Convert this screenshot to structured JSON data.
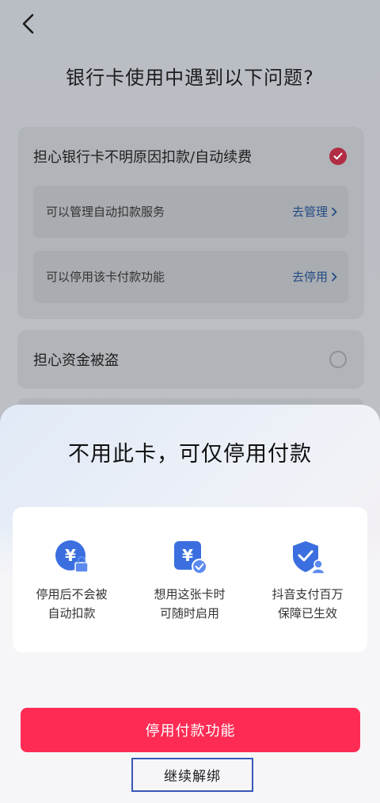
{
  "header": {
    "title": "银行卡使用中遇到以下问题?"
  },
  "issues": [
    {
      "label": "担心银行卡不明原因扣款/自动续费",
      "checked": true,
      "options": [
        {
          "label": "可以管理自动扣款服务",
          "action": "去管理"
        },
        {
          "label": "可以停用该卡付款功能",
          "action": "去停用"
        }
      ]
    },
    {
      "label": "担心资金被盗",
      "checked": false
    }
  ],
  "sheet": {
    "title": "不用此卡，可仅停用付款",
    "benefits": [
      {
        "icon": "yuan-lock-icon",
        "line1": "停用后不会被",
        "line2": "自动扣款"
      },
      {
        "icon": "yuan-card-check-icon",
        "line1": "想用这张卡时",
        "line2": "可随时启用"
      },
      {
        "icon": "shield-user-icon",
        "line1": "抖音支付百万",
        "line2": "保障已生效"
      }
    ],
    "primary_button": "停用付款功能",
    "secondary_button": "继续解绑"
  },
  "colors": {
    "brand_red": "#fe2c55",
    "icon_blue": "#3b6fe0",
    "link_blue": "#244b86",
    "highlight_border": "#3a57b8"
  }
}
